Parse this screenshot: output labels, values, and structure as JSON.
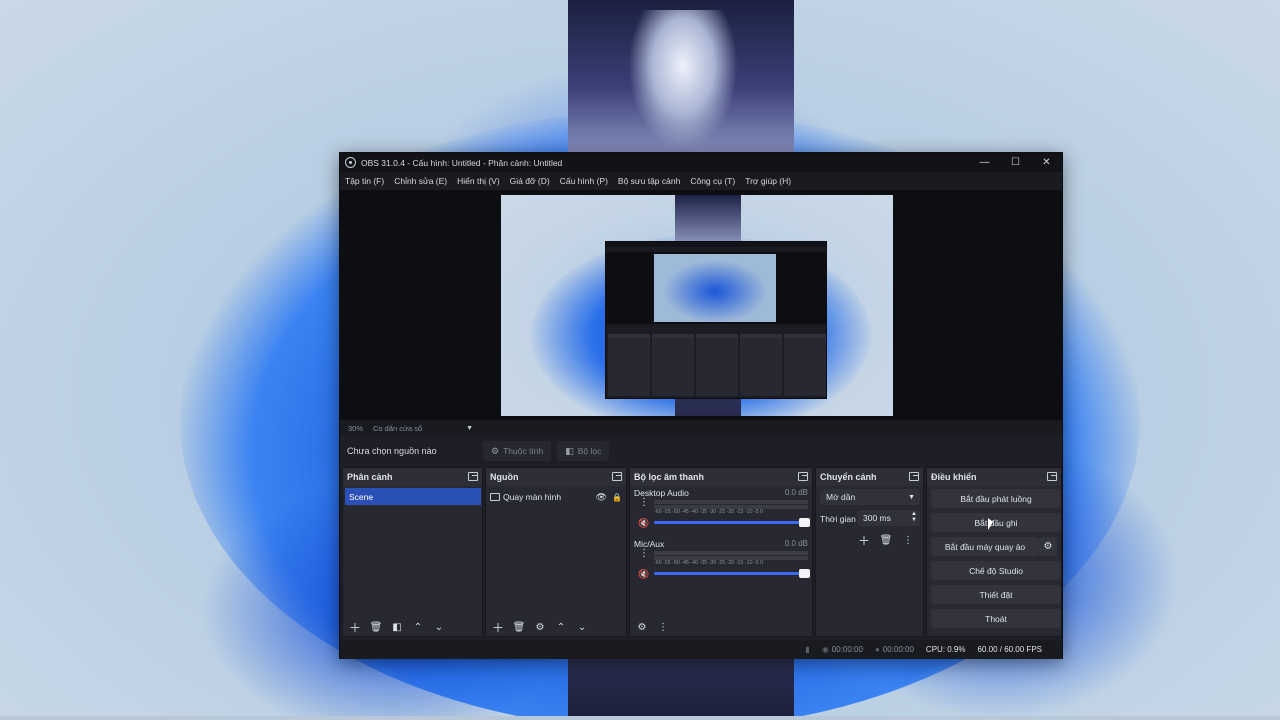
{
  "window": {
    "title": "OBS 31.0.4 - Cấu hình: Untitled - Phân cảnh: Untitled",
    "controls": {
      "minimize": "—",
      "maximize": "☐",
      "close": "✕"
    }
  },
  "menu": [
    "Tập tin (F)",
    "Chỉnh sửa (E)",
    "Hiển thị (V)",
    "Giá đỡ (D)",
    "Cấu hình (P)",
    "Bộ sưu tập cảnh",
    "Công cụ (T)",
    "Trợ giúp (H)"
  ],
  "preview": {
    "zoom": "30%",
    "scale_mode": "Co dãn cửa sổ"
  },
  "source_bar": {
    "no_source": "Chưa chọn nguồn nào",
    "properties": "Thuộc tính",
    "filters": "Bộ lọc"
  },
  "scenes": {
    "title": "Phân cảnh",
    "items": [
      "Scene"
    ]
  },
  "sources": {
    "title": "Nguồn",
    "items": [
      {
        "name": "Quay màn hình"
      }
    ]
  },
  "mixer": {
    "title": "Bộ lọc âm thanh",
    "ticks": "-60 -55 -50 -45 -40 -35 -30 -25 -20 -15 -10 -5 0",
    "channels": [
      {
        "name": "Desktop Audio",
        "db": "0.0 dB",
        "volume_fraction": 1.0
      },
      {
        "name": "Mic/Aux",
        "db": "0.0 dB",
        "volume_fraction": 1.0
      }
    ]
  },
  "transitions": {
    "title": "Chuyển cảnh",
    "type": "Mờ dần",
    "duration_label": "Thời gian",
    "duration": "300 ms"
  },
  "controls": {
    "title": "Điều khiển",
    "start_streaming": "Bắt đầu phát luồng",
    "start_recording": "Bắt đầu ghi",
    "start_virtual_camera": "Bắt đầu máy quay ảo",
    "studio_mode": "Chế độ Studio",
    "settings": "Thiết đặt",
    "exit": "Thoát"
  },
  "status": {
    "stream_time": "00:00:00",
    "record_time": "00:00:00",
    "cpu": "CPU: 0.9%",
    "fps": "60.00 / 60.00 FPS"
  },
  "colors": {
    "accent": "#2a50b8",
    "slider": "#3b6cf0",
    "mute": "#e0453a",
    "window_bg": "#1e1f26"
  }
}
